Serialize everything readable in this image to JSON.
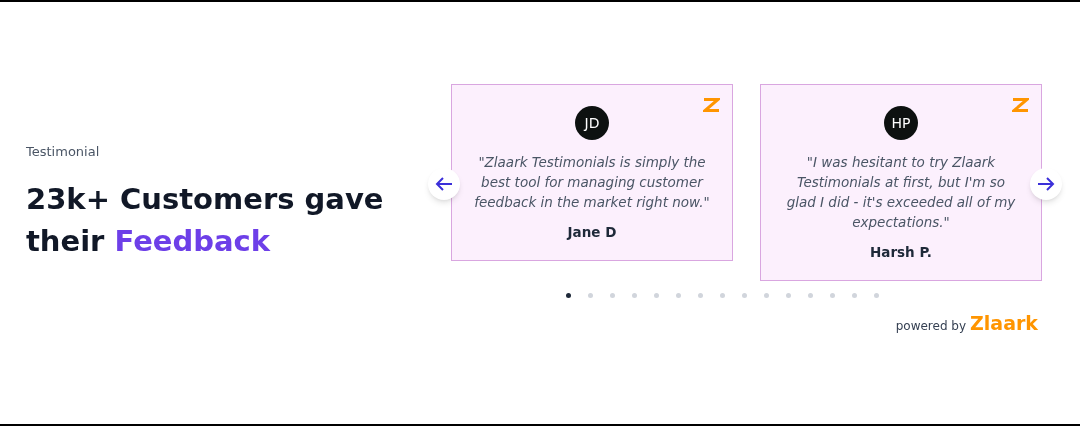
{
  "eyebrow": "Testimonial",
  "heading": {
    "text": "23k+ Customers gave their",
    "highlight": "Feedback"
  },
  "testimonials": [
    {
      "initials": "JD",
      "quote": "\"Zlaark Testimonials is simply the best tool for managing customer feedback in the market right now.\"",
      "author": "Jane D"
    },
    {
      "initials": "HP",
      "quote": "\"I was hesitant to try Zlaark Testimonials at first, but I'm so glad I did - it's exceeded all of my expectations.\"",
      "author": "Harsh P."
    }
  ],
  "pagination": [
    {
      "selected": true
    },
    {
      "selected": false
    },
    {
      "selected": false
    },
    {
      "selected": false
    },
    {
      "selected": false
    },
    {
      "selected": false
    },
    {
      "selected": false
    },
    {
      "selected": false
    },
    {
      "selected": false
    },
    {
      "selected": false
    },
    {
      "selected": false
    },
    {
      "selected": false
    },
    {
      "selected": false
    },
    {
      "selected": false
    },
    {
      "selected": false
    }
  ],
  "powered_by": {
    "label": "powered by",
    "brand": "Zlaark"
  }
}
